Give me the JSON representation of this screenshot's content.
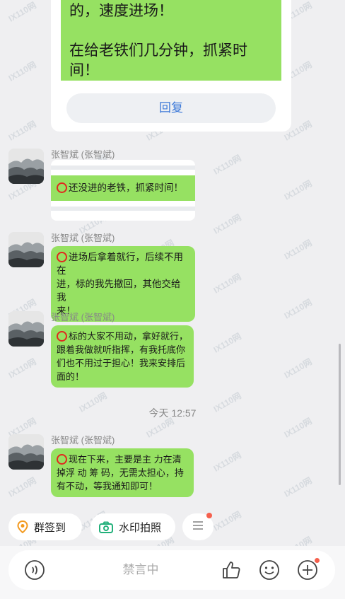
{
  "watermark": "IX110网",
  "top_card": {
    "lines_a": [
      "的，速度进场！"
    ],
    "lines_b": [
      "在给老铁们几分钟，抓紧时",
      "间！"
    ],
    "reply_label": "回复"
  },
  "messages": [
    {
      "sender": "张智斌 (张智斌)",
      "text": "还没进的老铁，抓紧时间！"
    },
    {
      "sender": "张智斌 (张智斌)",
      "lines": [
        "进场后拿着就行，后续不用在",
        "进，标的我先撤回，其他交给我",
        "来！"
      ]
    },
    {
      "sender": "张智斌 (张智斌)",
      "lines": [
        "标的大家不用动，拿好就行，",
        "跟着我做就听指挥，有我托底你",
        "们也不用过于担心！我来安排后",
        "面的！"
      ]
    },
    {
      "sender": "张智斌 (张智斌)",
      "lines": [
        "现在下来，主要是主 力在清",
        "掉浮 动 筹 码，无需太担心，持",
        "有不动，等我通知即可！"
      ]
    }
  ],
  "timestamp": "今天 12:57",
  "quick_actions": {
    "checkin_label": "群签到",
    "watermark_photo_label": "水印拍照"
  },
  "input": {
    "placeholder": "禁言中"
  },
  "colors": {
    "bubble": "#96e162",
    "accent_blue": "#3b78d8",
    "ring_red": "#e0291f",
    "notify_dot": "#f5604d"
  }
}
